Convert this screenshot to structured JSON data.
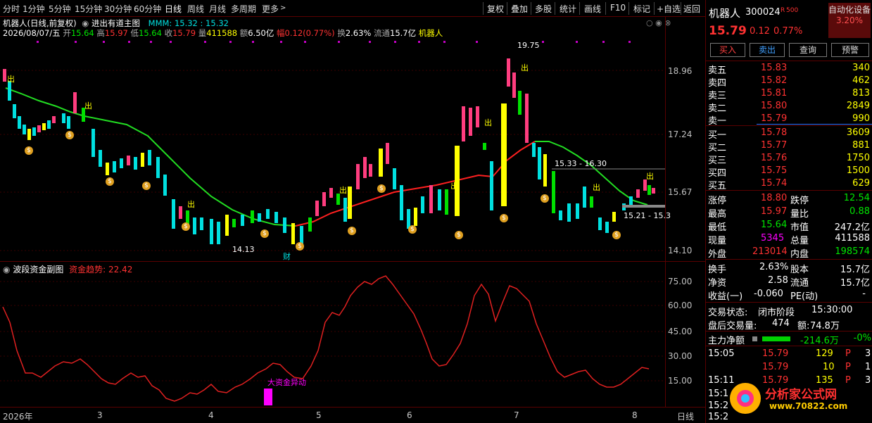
{
  "toolbar": {
    "periods": [
      "分时",
      "1分钟",
      "5分钟",
      "15分钟",
      "30分钟",
      "60分钟",
      "日线",
      "周线",
      "月线",
      "多周期",
      "更多"
    ],
    "active": "日线",
    "right_items": [
      "复权",
      "叠加",
      "多股",
      "统计",
      "画线",
      "F10",
      "标记",
      "+自选",
      "返回"
    ]
  },
  "stock": {
    "name": "机器人",
    "code": "300024",
    "flag": "R",
    "margin": "500",
    "title_line": "机器人(日线,前复权)",
    "indicator_main": "进出有道主图",
    "mmm_label": "MMM: 15.32 : 15.32",
    "date": "2026/08/07/五",
    "open_label": "开",
    "open": "15.64",
    "high_label": "高",
    "high": "15.97",
    "low_label": "低",
    "low": "15.64",
    "close_label": "收",
    "close": "15.79",
    "vol_label": "量",
    "vol": "411588",
    "amount_label": "额",
    "amount": "6.50亿",
    "amp_label": "幅",
    "change": "0.12(0.77%)",
    "turn_label": "换",
    "turnover": "2.63%",
    "float_label": "流通",
    "float_val": "15.7亿",
    "sector": "机器人"
  },
  "axis_main": [
    "18.96",
    "17.24",
    "15.67",
    "14.10"
  ],
  "axis_sub": [
    "75.00",
    "60.00",
    "45.00",
    "30.00",
    "15.00"
  ],
  "annotations": {
    "high_mark": "19.75",
    "low_mark": "14.13",
    "range1": "15.33 - 16.30",
    "range2": "15.21 - 15.3",
    "cai": "财",
    "out": "出",
    "money": "$",
    "big_fund": "大资金异动"
  },
  "sub_chart": {
    "name": "波段资金副图",
    "trend_label": "资金趋势:",
    "trend_value": "22.42"
  },
  "dates": {
    "year": "2026年",
    "labels": [
      "3",
      "4",
      "5",
      "6",
      "7",
      "8"
    ],
    "period": "日线"
  },
  "right_panel": {
    "auto_label": "自动化设备",
    "auto_pct": "3.20%",
    "price": "15.79",
    "change": "0.12",
    "change_pct": "0.77%",
    "buttons": [
      "买入",
      "卖出",
      "查询",
      "预警"
    ],
    "asks": [
      {
        "label": "卖五",
        "price": "15.83",
        "vol": "340"
      },
      {
        "label": "卖四",
        "price": "15.82",
        "vol": "462"
      },
      {
        "label": "卖三",
        "price": "15.81",
        "vol": "813"
      },
      {
        "label": "卖二",
        "price": "15.80",
        "vol": "2849"
      },
      {
        "label": "卖一",
        "price": "15.79",
        "vol": "990"
      }
    ],
    "bids": [
      {
        "label": "买一",
        "price": "15.78",
        "vol": "3609"
      },
      {
        "label": "买二",
        "price": "15.77",
        "vol": "881"
      },
      {
        "label": "买三",
        "price": "15.76",
        "vol": "1750"
      },
      {
        "label": "买四",
        "price": "15.75",
        "vol": "1500"
      },
      {
        "label": "买五",
        "price": "15.74",
        "vol": "629"
      }
    ],
    "stats": [
      {
        "l1": "涨停",
        "v1": "18.80",
        "l2": "跌停",
        "v2": "12.54"
      },
      {
        "l1": "最高",
        "v1": "15.97",
        "l2": "量比",
        "v2": "0.88"
      },
      {
        "l1": "最低",
        "v1": "15.64",
        "l2": "市值",
        "v2": "247.2亿"
      },
      {
        "l1": "现量",
        "v1": "5345",
        "l2": "总量",
        "v2": "411588"
      },
      {
        "l1": "外盘",
        "v1": "213014",
        "l2": "内盘",
        "v2": "198574"
      }
    ],
    "stats2": [
      {
        "l1": "换手",
        "v1": "2.63%",
        "l2": "股本",
        "v2": "15.7亿"
      },
      {
        "l1": "净资",
        "v1": "2.58",
        "l2": "流通",
        "v2": "15.7亿"
      },
      {
        "l1": "收益(一)",
        "v1": "-0.060",
        "l2": "PE(动)",
        "v2": "-"
      }
    ],
    "trade_status_label": "交易状态:",
    "trade_status": "闭市阶段",
    "trade_time": "15:30:00",
    "after_label": "盘后交易量:",
    "after_vol": "474",
    "after_amt_label": "额:",
    "after_amt": "74.8万",
    "main_net_label": "主力净额",
    "main_net": "-214.6万",
    "main_net_pct": "-0%",
    "ticks": [
      {
        "time": "15:05",
        "price": "15.79",
        "vol": "129",
        "flag": "P",
        "n": "3"
      },
      {
        "time": "",
        "price": "15.79",
        "vol": "10",
        "flag": "P",
        "n": "1"
      },
      {
        "time": "15:11",
        "price": "15.79",
        "vol": "135",
        "flag": "P",
        "n": "3"
      },
      {
        "time": "15:1",
        "price": "",
        "vol": "",
        "flag": "",
        "n": ""
      },
      {
        "time": "15:2",
        "price": "",
        "vol": "",
        "flag": "",
        "n": ""
      },
      {
        "time": "15:2",
        "price": "",
        "vol": "",
        "flag": "",
        "n": ""
      }
    ],
    "logo_text": "分析家公式网",
    "logo_url": "www.70822.com"
  },
  "watermark": "分析家公式网-www.70822.com"
}
